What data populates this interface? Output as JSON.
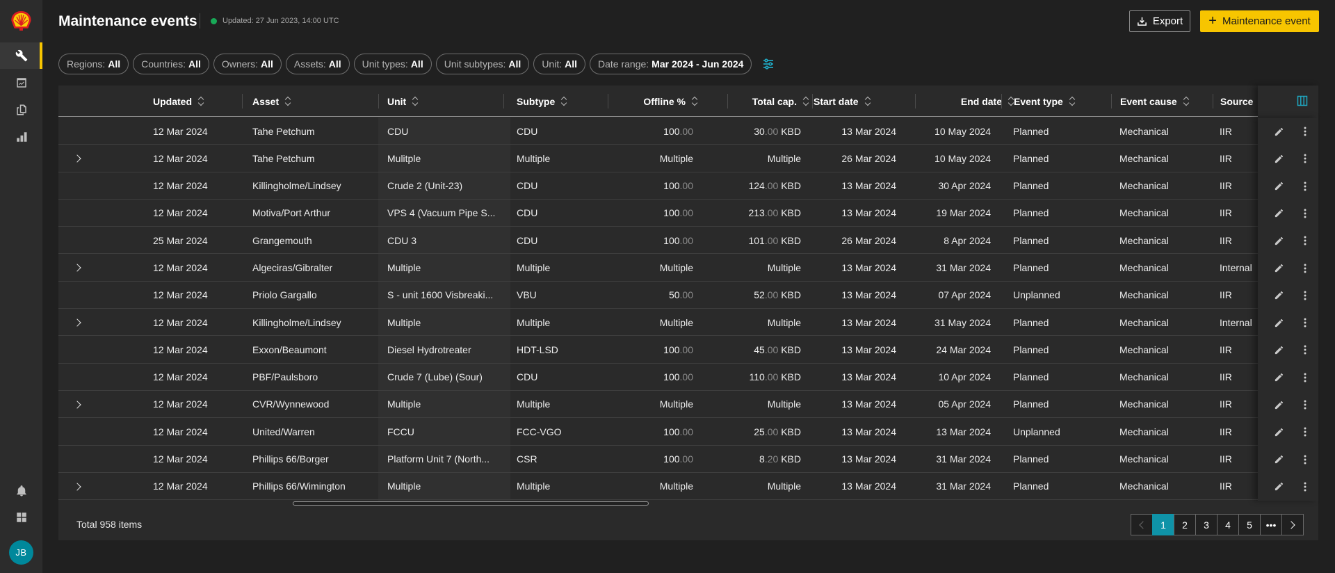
{
  "app": {
    "title": "Maintenance events",
    "updated": "Updated: 27 Jun 2023, 14:00 UTC",
    "status_color": "#18a957",
    "brand_color": "#f7c500",
    "logo": "shell-logo"
  },
  "sidebar": {
    "items": [
      {
        "icon": "wrench-icon",
        "active": true
      },
      {
        "icon": "calendar-chart-icon",
        "active": false
      },
      {
        "icon": "documents-icon",
        "active": false
      },
      {
        "icon": "bar-chart-icon",
        "active": false
      }
    ],
    "bottom": [
      {
        "icon": "bell-icon"
      },
      {
        "icon": "grid-icon"
      }
    ],
    "avatar": "JB"
  },
  "toolbar": {
    "export_label": "Export",
    "add_label": "Maintenance event"
  },
  "filters": [
    {
      "label": "Regions:",
      "value": "All"
    },
    {
      "label": "Countries:",
      "value": "All"
    },
    {
      "label": "Owners:",
      "value": "All"
    },
    {
      "label": "Assets:",
      "value": "All"
    },
    {
      "label": "Unit types:",
      "value": "All"
    },
    {
      "label": "Unit subtypes:",
      "value": "All"
    },
    {
      "label": "Unit:",
      "value": "All"
    },
    {
      "label": "Date range:",
      "value": "Mar 2024 - Jun 2024"
    }
  ],
  "table": {
    "columns": [
      "Updated",
      "Asset",
      "Unit",
      "Subtype",
      "Offline %",
      "Total cap.",
      "Start date",
      "End date",
      "Event type",
      "Event cause",
      "Source"
    ],
    "rows": [
      {
        "expandable": false,
        "updated": "12 Mar 2024",
        "asset": "Tahe Petchum",
        "unit": "CDU",
        "subtype": "CDU",
        "offline_int": "100",
        "offline_dec": ".00",
        "cap_int": "30",
        "cap_dec": ".00",
        "cap_unit": " KBD",
        "start": "13 Mar 2024",
        "end": "10 May 2024",
        "type": "Planned",
        "cause": "Mechanical",
        "source": "IIR"
      },
      {
        "expandable": true,
        "updated": "12 Mar 2024",
        "asset": "Tahe Petchum",
        "unit": "Mulitple",
        "subtype": "Multiple",
        "offline_int": "Multiple",
        "offline_dec": "",
        "cap_int": "Multiple",
        "cap_dec": "",
        "cap_unit": "",
        "start": "26 Mar 2024",
        "end": "10 May 2024",
        "type": "Planned",
        "cause": "Mechanical",
        "source": "IIR"
      },
      {
        "expandable": false,
        "updated": "12 Mar 2024",
        "asset": "Killingholme/Lindsey",
        "unit": "Crude 2 (Unit-23)",
        "subtype": "CDU",
        "offline_int": "100",
        "offline_dec": ".00",
        "cap_int": "124",
        "cap_dec": ".00",
        "cap_unit": " KBD",
        "start": "13 Mar 2024",
        "end": "30 Apr 2024",
        "type": "Planned",
        "cause": "Mechanical",
        "source": "IIR"
      },
      {
        "expandable": false,
        "updated": "12 Mar 2024",
        "asset": "Motiva/Port Arthur",
        "unit": "VPS 4 (Vacuum Pipe S...",
        "subtype": "CDU",
        "offline_int": "100",
        "offline_dec": ".00",
        "cap_int": "213",
        "cap_dec": ".00",
        "cap_unit": " KBD",
        "start": "13 Mar 2024",
        "end": "19 Mar 2024",
        "type": "Planned",
        "cause": "Mechanical",
        "source": "IIR"
      },
      {
        "expandable": false,
        "updated": "25 Mar 2024",
        "asset": "Grangemouth",
        "unit": "CDU 3",
        "subtype": "CDU",
        "offline_int": "100",
        "offline_dec": ".00",
        "cap_int": "101",
        "cap_dec": ".00",
        "cap_unit": " KBD",
        "start": "26 Mar 2024",
        "end": "8 Apr 2024",
        "type": "Planned",
        "cause": "Mechanical",
        "source": "IIR"
      },
      {
        "expandable": true,
        "updated": "12 Mar 2024",
        "asset": "Algeciras/Gibralter",
        "unit": "Multiple",
        "subtype": "Multiple",
        "offline_int": "Multiple",
        "offline_dec": "",
        "cap_int": "Multiple",
        "cap_dec": "",
        "cap_unit": "",
        "start": "13 Mar 2024",
        "end": "31 Mar 2024",
        "type": "Planned",
        "cause": "Mechanical",
        "source": "Internal"
      },
      {
        "expandable": false,
        "updated": "12 Mar 2024",
        "asset": "Priolo Gargallo",
        "unit": "S - unit 1600 Visbreaki...",
        "subtype": "VBU",
        "offline_int": "50",
        "offline_dec": ".00",
        "cap_int": "52",
        "cap_dec": ".00",
        "cap_unit": " KBD",
        "start": "13 Mar 2024",
        "end": "07 Apr 2024",
        "type": "Unplanned",
        "cause": "Mechanical",
        "source": "IIR"
      },
      {
        "expandable": true,
        "updated": "12 Mar 2024",
        "asset": "Killingholme/Lindsey",
        "unit": "Multiple",
        "subtype": "Multiple",
        "offline_int": "Multiple",
        "offline_dec": "",
        "cap_int": "Multiple",
        "cap_dec": "",
        "cap_unit": "",
        "start": "13 Mar 2024",
        "end": "31 May 2024",
        "type": "Planned",
        "cause": "Mechanical",
        "source": "Internal"
      },
      {
        "expandable": false,
        "updated": "12 Mar 2024",
        "asset": "Exxon/Beaumont",
        "unit": "Diesel Hydrotreater",
        "subtype": "HDT-LSD",
        "offline_int": "100",
        "offline_dec": ".00",
        "cap_int": "45",
        "cap_dec": ".00",
        "cap_unit": " KBD",
        "start": "13 Mar 2024",
        "end": "24 Mar 2024",
        "type": "Planned",
        "cause": "Mechanical",
        "source": "IIR"
      },
      {
        "expandable": false,
        "updated": "12 Mar 2024",
        "asset": "PBF/Paulsboro",
        "unit": "Crude 7 (Lube) (Sour)",
        "subtype": "CDU",
        "offline_int": "100",
        "offline_dec": ".00",
        "cap_int": "110",
        "cap_dec": ".00",
        "cap_unit": " KBD",
        "start": "13 Mar 2024",
        "end": "10 Apr 2024",
        "type": "Planned",
        "cause": "Mechanical",
        "source": "IIR"
      },
      {
        "expandable": true,
        "updated": "12 Mar 2024",
        "asset": "CVR/Wynnewood",
        "unit": "Multiple",
        "subtype": "Multiple",
        "offline_int": "Multiple",
        "offline_dec": "",
        "cap_int": "Multiple",
        "cap_dec": "",
        "cap_unit": "",
        "start": "13 Mar 2024",
        "end": "05 Apr 2024",
        "type": "Planned",
        "cause": "Mechanical",
        "source": "IIR"
      },
      {
        "expandable": false,
        "updated": "12 Mar 2024",
        "asset": "United/Warren",
        "unit": "FCCU",
        "subtype": "FCC-VGO",
        "offline_int": "100",
        "offline_dec": ".00",
        "cap_int": "25",
        "cap_dec": ".00",
        "cap_unit": " KBD",
        "start": "13 Mar 2024",
        "end": "13 Mar 2024",
        "type": "Unplanned",
        "cause": "Mechanical",
        "source": "IIR"
      },
      {
        "expandable": false,
        "updated": "12 Mar 2024",
        "asset": "Phillips 66/Borger",
        "unit": "Platform Unit 7 (North...",
        "subtype": "CSR",
        "offline_int": "100",
        "offline_dec": ".00",
        "cap_int": "8",
        "cap_dec": ".20",
        "cap_unit": " KBD",
        "start": "13 Mar 2024",
        "end": "31 Mar 2024",
        "type": "Planned",
        "cause": "Mechanical",
        "source": "IIR"
      },
      {
        "expandable": true,
        "updated": "12 Mar 2024",
        "asset": "Phillips 66/Wimington",
        "unit": "Multiple",
        "subtype": "Multiple",
        "offline_int": "Multiple",
        "offline_dec": "",
        "cap_int": "Multiple",
        "cap_dec": "",
        "cap_unit": "",
        "start": "13 Mar 2024",
        "end": "31 Mar 2024",
        "type": "Planned",
        "cause": "Mechanical",
        "source": "IIR"
      }
    ]
  },
  "footer": {
    "total": "Total 958 items",
    "pages": [
      "1",
      "2",
      "3",
      "4",
      "5",
      "•••"
    ],
    "current_page": "1"
  }
}
